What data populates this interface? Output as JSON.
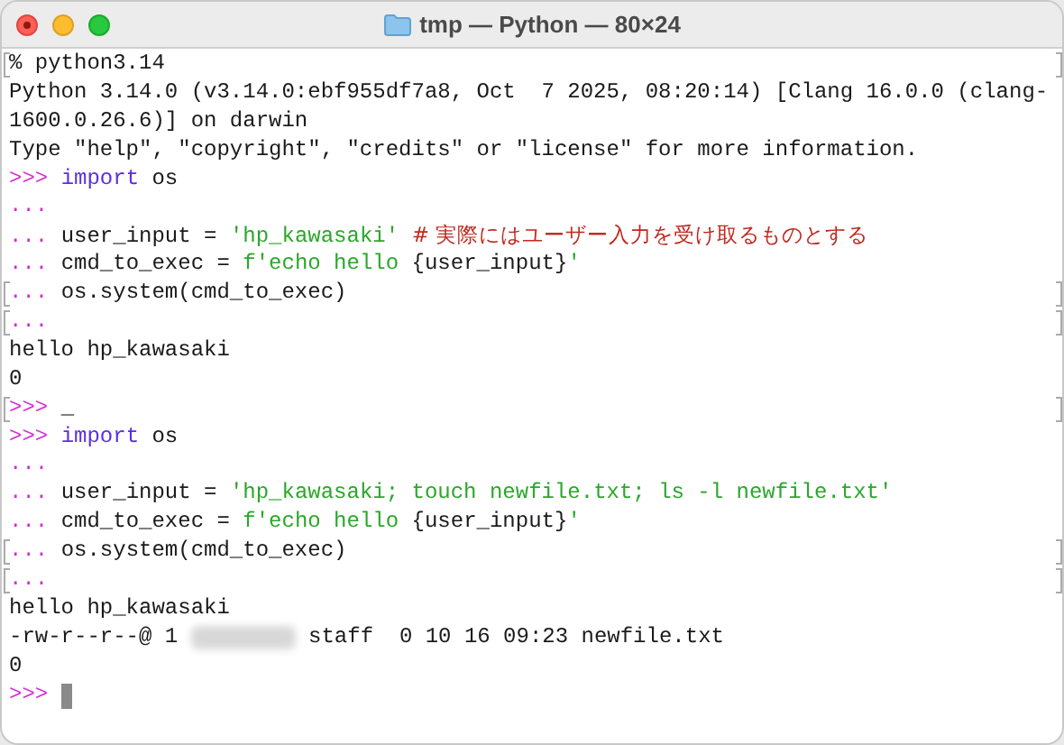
{
  "window": {
    "title": "tmp — Python — 80×24"
  },
  "lines": [
    {
      "marked": true,
      "segments": [
        {
          "kind": "plain",
          "text": "% python3.14"
        }
      ]
    },
    {
      "marked": false,
      "segments": [
        {
          "kind": "plain",
          "text": "Python 3.14.0 (v3.14.0:ebf955df7a8, Oct  7 2025, 08:20:14) [Clang 16.0.0 (clang-"
        }
      ]
    },
    {
      "marked": false,
      "segments": [
        {
          "kind": "plain",
          "text": "1600.0.26.6)] on darwin"
        }
      ]
    },
    {
      "marked": false,
      "segments": [
        {
          "kind": "plain",
          "text": "Type \"help\", \"copyright\", \"credits\" or \"license\" for more information."
        }
      ]
    },
    {
      "marked": false,
      "segments": [
        {
          "kind": "prompt",
          "text": ">>> "
        },
        {
          "kind": "keyword",
          "text": "import"
        },
        {
          "kind": "plain",
          "text": " os"
        }
      ]
    },
    {
      "marked": false,
      "segments": [
        {
          "kind": "prompt",
          "text": "..."
        }
      ]
    },
    {
      "marked": false,
      "segments": [
        {
          "kind": "prompt",
          "text": "... "
        },
        {
          "kind": "plain",
          "text": "user_input = "
        },
        {
          "kind": "string",
          "text": "'hp_kawasaki'"
        },
        {
          "kind": "comment",
          "text": "  # 実際にはユーザー入力を受け取るものとする"
        }
      ]
    },
    {
      "marked": false,
      "segments": [
        {
          "kind": "prompt",
          "text": "... "
        },
        {
          "kind": "plain",
          "text": "cmd_to_exec = "
        },
        {
          "kind": "string",
          "text": "f'echo hello "
        },
        {
          "kind": "plain",
          "text": "{user_input}"
        },
        {
          "kind": "string",
          "text": "'"
        }
      ]
    },
    {
      "marked": true,
      "segments": [
        {
          "kind": "prompt",
          "text": "... "
        },
        {
          "kind": "plain",
          "text": "os.system(cmd_to_exec)"
        }
      ]
    },
    {
      "marked": true,
      "segments": [
        {
          "kind": "prompt",
          "text": "..."
        }
      ]
    },
    {
      "marked": false,
      "segments": [
        {
          "kind": "plain",
          "text": "hello hp_kawasaki"
        }
      ]
    },
    {
      "marked": false,
      "segments": [
        {
          "kind": "plain",
          "text": "0"
        }
      ]
    },
    {
      "marked": true,
      "segments": [
        {
          "kind": "prompt",
          "text": ">>> "
        },
        {
          "kind": "plain",
          "text": "_"
        }
      ]
    },
    {
      "marked": false,
      "segments": [
        {
          "kind": "prompt",
          "text": ">>> "
        },
        {
          "kind": "keyword",
          "text": "import"
        },
        {
          "kind": "plain",
          "text": " os"
        }
      ]
    },
    {
      "marked": false,
      "segments": [
        {
          "kind": "prompt",
          "text": "..."
        }
      ]
    },
    {
      "marked": false,
      "segments": [
        {
          "kind": "prompt",
          "text": "... "
        },
        {
          "kind": "plain",
          "text": "user_input = "
        },
        {
          "kind": "string",
          "text": "'hp_kawasaki; touch newfile.txt; ls -l newfile.txt'"
        }
      ]
    },
    {
      "marked": false,
      "segments": [
        {
          "kind": "prompt",
          "text": "... "
        },
        {
          "kind": "plain",
          "text": "cmd_to_exec = "
        },
        {
          "kind": "string",
          "text": "f'echo hello "
        },
        {
          "kind": "plain",
          "text": "{user_input}"
        },
        {
          "kind": "string",
          "text": "'"
        }
      ]
    },
    {
      "marked": true,
      "segments": [
        {
          "kind": "prompt",
          "text": "... "
        },
        {
          "kind": "plain",
          "text": "os.system(cmd_to_exec)"
        }
      ]
    },
    {
      "marked": true,
      "segments": [
        {
          "kind": "prompt",
          "text": "..."
        }
      ]
    },
    {
      "marked": false,
      "segments": [
        {
          "kind": "plain",
          "text": "hello hp_kawasaki"
        }
      ]
    },
    {
      "marked": false,
      "segments": [
        {
          "kind": "plain",
          "text": "-rw-r--r--@ 1 "
        },
        {
          "kind": "redacted"
        },
        {
          "kind": "plain",
          "text": " staff  0 10 16 09:23 newfile.txt"
        }
      ]
    },
    {
      "marked": false,
      "segments": [
        {
          "kind": "plain",
          "text": "0"
        }
      ]
    },
    {
      "marked": false,
      "segments": [
        {
          "kind": "prompt",
          "text": ">>> "
        },
        {
          "kind": "cursor"
        }
      ]
    }
  ]
}
